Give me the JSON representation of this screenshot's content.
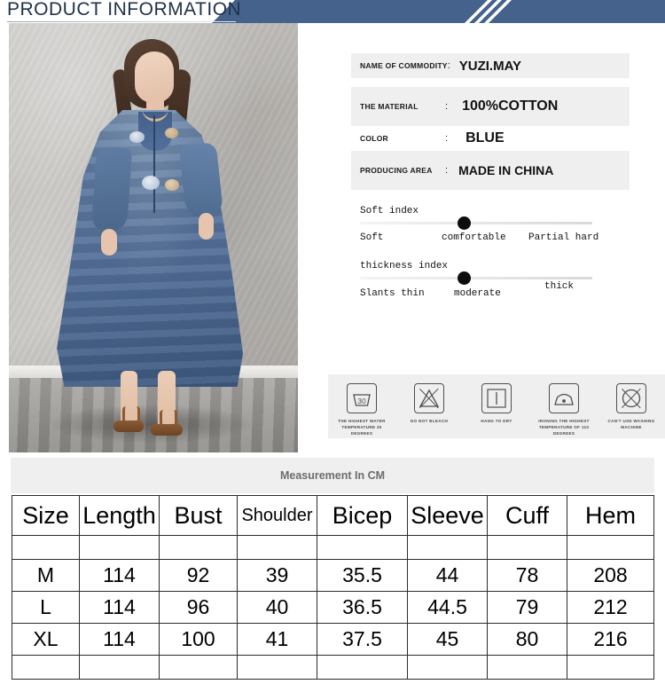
{
  "header": {
    "title": "PRODUCT INFORMATION",
    "banner_color": "#45628c"
  },
  "photo": {
    "alt_name": "model-wearing-blue-denim-dress"
  },
  "info": {
    "rows": [
      {
        "label": "NAME OF COMMODITY",
        "colon": ":",
        "value": "YUZI.MAY",
        "shaded": true
      },
      {
        "label": "THE MATERIAL",
        "colon": ":",
        "value": "100%COTTON",
        "shaded": true
      },
      {
        "label": "COLOR",
        "colon": ":",
        "value": "BLUE",
        "shaded": false
      },
      {
        "label": "PRODUCING AREA",
        "colon": ":",
        "value": "MADE IN CHINA",
        "shaded": true
      }
    ]
  },
  "sliders": [
    {
      "title": "Soft index",
      "value_percent": 45,
      "labels": [
        "Soft",
        "comfortable",
        "Partial hard"
      ]
    },
    {
      "title": "thickness index",
      "value_percent": 45,
      "labels": [
        "Slants thin",
        "moderate",
        "thick"
      ]
    }
  ],
  "care": {
    "items": [
      {
        "icon": "wash-tub-30-icon",
        "temp": "30",
        "caption": "THE HIGHEST WATER TEMPERATURE 30 DEGREES"
      },
      {
        "icon": "do-not-bleach-icon",
        "caption": "DO NOT BLEACH"
      },
      {
        "icon": "hang-to-dry-icon",
        "caption": "HANG TO DRY"
      },
      {
        "icon": "iron-low-heat-icon",
        "caption": "IRONING THE HIGHEST TEMPERATURE OF 110 DEGREES"
      },
      {
        "icon": "no-washing-machine-icon",
        "caption": "CAN'T USE WASHING MACHINE"
      }
    ]
  },
  "measurement": {
    "bar_label": "Measurement In CM"
  },
  "size_table": {
    "headers": [
      "Size",
      "Length",
      "Bust",
      "Shoulder",
      "Bicep",
      "Sleeve",
      "Cuff",
      "Hem"
    ],
    "rows": [
      [
        "M",
        "114",
        "92",
        "39",
        "35.5",
        "44",
        "78",
        "208"
      ],
      [
        "L",
        "114",
        "96",
        "40",
        "36.5",
        "44.5",
        "79",
        "212"
      ],
      [
        "XL",
        "114",
        "100",
        "41",
        "37.5",
        "45",
        "80",
        "216"
      ]
    ]
  }
}
